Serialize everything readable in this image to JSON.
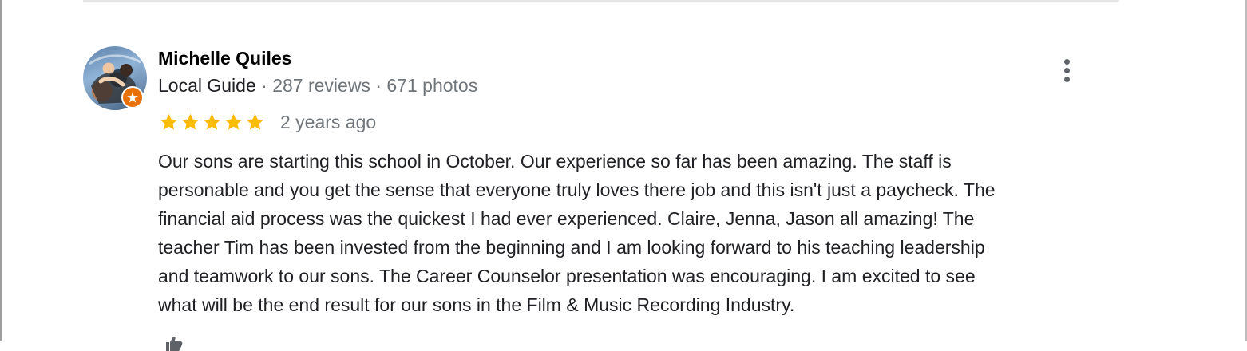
{
  "review": {
    "reviewer": {
      "name": "Michelle Quiles",
      "badge": "Local Guide",
      "separator": " · ",
      "reviews_count": "287 reviews",
      "photos_count": "671 photos"
    },
    "rating": 5,
    "max_rating": 5,
    "time_ago": "2 years ago",
    "text": "Our sons are starting this school in October.  Our experience so far has been amazing. The staff is\npersonable and you get the sense that everyone truly loves there job and this isn't just a paycheck.  The\nfinancial aid process was the quickest I had ever experienced.  Claire, Jenna, Jason all amazing! The\nteacher Tim has been invested from the beginning and I am looking forward to his teaching leadership\nand teamwork to our sons. The Career Counselor presentation was encouraging.  I am excited to see\nwhat will be the end result for our sons in the Film & Music Recording Industry.",
    "icons": {
      "avatar": "reviewer-photo",
      "local_guide_badge": "local-guide-star-icon",
      "star": "star-icon",
      "more": "more-vertical-icon",
      "like": "thumbs-up-icon"
    }
  },
  "colors": {
    "star": "#fbbc04",
    "badge": "#e8710a",
    "name": "#000000",
    "meta": "#70757a",
    "text": "#202124"
  }
}
